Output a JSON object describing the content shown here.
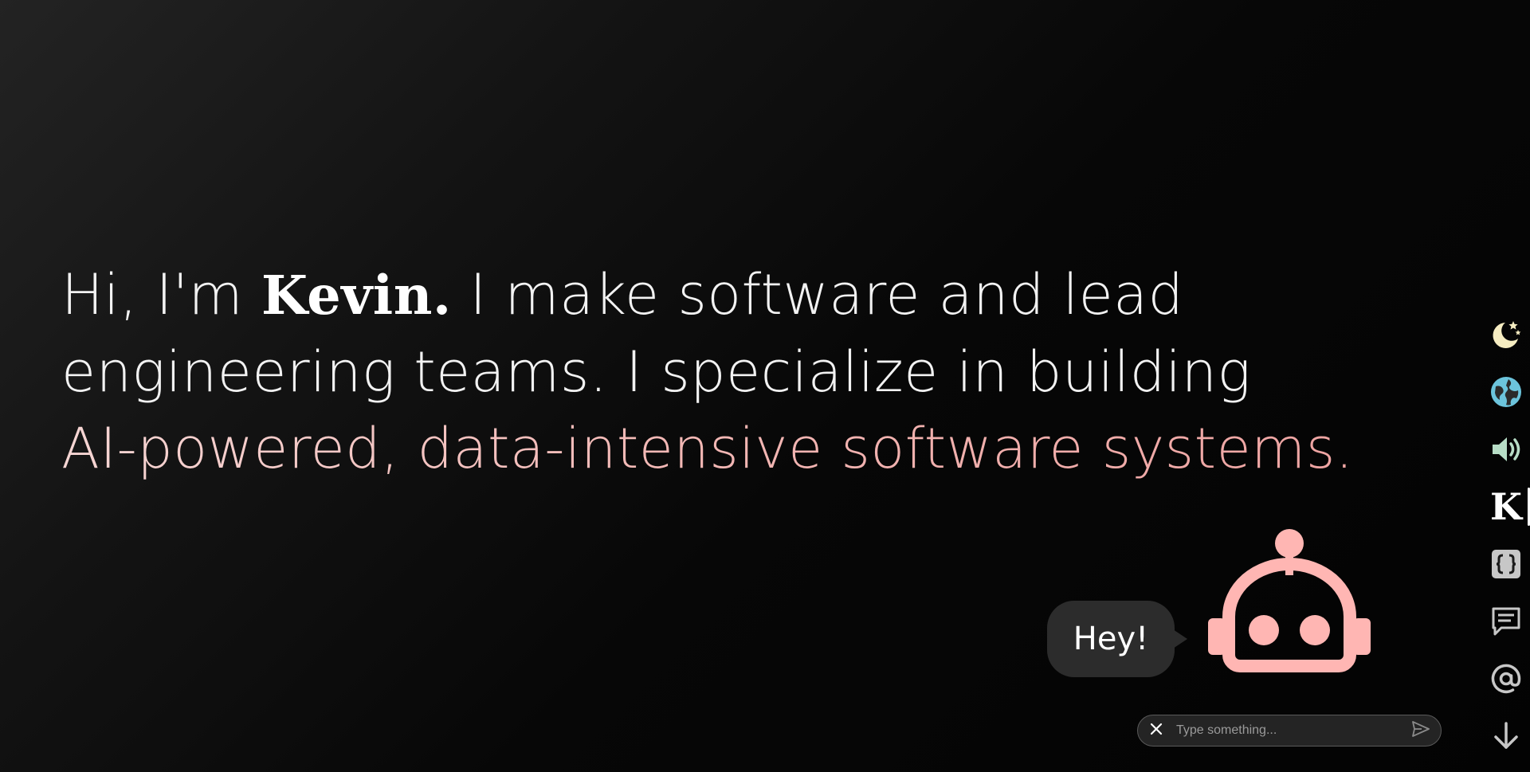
{
  "hero": {
    "intro": "Hi, I'm ",
    "name": "Kevin.",
    "line1_rest": " I make software and lead",
    "line2": "engineering teams. I specialize in building",
    "line3": "AI-powered, data-intensive software systems."
  },
  "rail": {
    "items": [
      {
        "icon": "moon-stars-icon",
        "color": "#f6edc2"
      },
      {
        "icon": "globe-icon",
        "color": "#6cc4dc"
      },
      {
        "icon": "speaker-icon",
        "color": "#b7ddc6"
      },
      {
        "icon": "k-logo",
        "label": "K",
        "active": true
      },
      {
        "icon": "code-braces-icon",
        "color": "#c7c7c7"
      },
      {
        "icon": "comment-icon",
        "color": "#c7c7c7"
      },
      {
        "icon": "at-icon",
        "color": "#c7c7c7"
      },
      {
        "icon": "arrow-down-icon",
        "color": "#c7c7c7"
      }
    ]
  },
  "chatbot": {
    "bubble_text": "Hey!",
    "robot_color": "#ffb6b3",
    "input_placeholder": "Type something..."
  },
  "colors": {
    "accent_gradient_start": "#f6d6d4",
    "accent_gradient_end": "#eea4a2",
    "background": "#0a0a0a"
  }
}
